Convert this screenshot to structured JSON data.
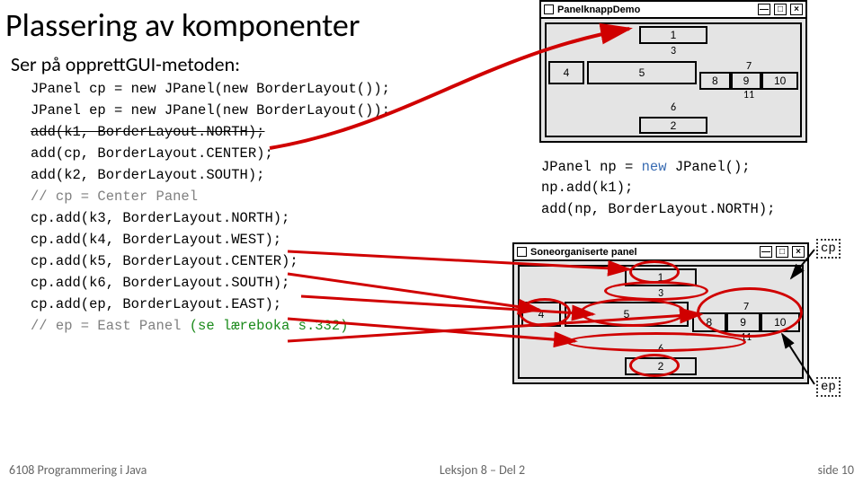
{
  "title": "Plassering av komponenter",
  "intro": "Ser på opprettGUI-metoden:",
  "code": {
    "lines": [
      {
        "t": "JPanel cp = new JPanel(new BorderLayout());",
        "k": "plain"
      },
      {
        "t": "JPanel ep = new JPanel(new BorderLayout());",
        "k": "plain"
      },
      {
        "t": "add(k1, BorderLayout.NORTH);",
        "k": "strike"
      },
      {
        "t": "add(cp, BorderLayout.CENTER);",
        "k": "plain"
      },
      {
        "t": "add(k2, BorderLayout.SOUTH);",
        "k": "plain"
      },
      {
        "t": "// cp = Center Panel",
        "k": "comment"
      },
      {
        "t": "cp.add(k3, BorderLayout.NORTH);",
        "k": "plain"
      },
      {
        "t": "cp.add(k4, BorderLayout.WEST);",
        "k": "plain"
      },
      {
        "t": "cp.add(k5, BorderLayout.CENTER);",
        "k": "plain"
      },
      {
        "t": "cp.add(k6, BorderLayout.SOUTH);",
        "k": "plain"
      },
      {
        "t": "cp.add(ep, BorderLayout.EAST);",
        "k": "plain"
      }
    ],
    "lastLineLead": "// ep = East Panel ",
    "lastLineTrail": "(se læreboka s.332)"
  },
  "rightCode": {
    "l1a": "JPanel np = ",
    "l1b": "new",
    "l1c": " JPanel();",
    "l2": "np.add(k1);",
    "l3": "add(np, BorderLayout.NORTH);"
  },
  "win1": {
    "title": "PanelknappDemo",
    "n": {
      "1": "1",
      "2": "2",
      "3": "3",
      "4": "4",
      "5": "5",
      "6": "6",
      "7": "7",
      "8": "8",
      "9": "9",
      "10": "10",
      "11": "11"
    }
  },
  "win2": {
    "title": "Soneorganiserte panel",
    "n": {
      "1": "1",
      "2": "2",
      "3": "3",
      "4": "4",
      "5": "5",
      "6": "6",
      "7": "7",
      "8": "8",
      "9": "9",
      "10": "10",
      "11": "11"
    }
  },
  "labels": {
    "cp": "cp",
    "ep": "ep"
  },
  "footer": {
    "left": "6108 Programmering i Java",
    "center": "Leksjon 8 – Del 2",
    "right": "side 10"
  }
}
